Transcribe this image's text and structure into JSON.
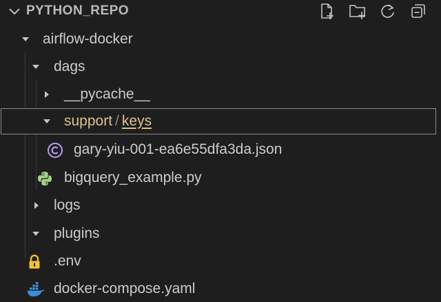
{
  "explorer": {
    "title": "PYTHON_REPO",
    "actions": [
      {
        "name": "new-file-icon"
      },
      {
        "name": "new-folder-icon"
      },
      {
        "name": "refresh-icon"
      },
      {
        "name": "collapse-all-icon"
      }
    ]
  },
  "tree": {
    "airflow_docker": "airflow-docker",
    "dags": "dags",
    "pycache": "__pycache__",
    "support": "support",
    "separator": "/",
    "keys": "keys",
    "json_file": "gary-yiu-001-ea6e55dfa3da.json",
    "bigquery": "bigquery_example.py",
    "logs": "logs",
    "plugins": "plugins",
    "env": ".env",
    "docker_compose": "docker-compose.yaml"
  },
  "colors": {
    "background": "#1e1e1e",
    "text": "#cccccc",
    "selected_folder": "#e2c08d",
    "python_icon": "#a6d189",
    "json_icon": "#b4a0f0",
    "lock_icon": "#f2c12e",
    "docker_icon": "#3d8fd6"
  }
}
